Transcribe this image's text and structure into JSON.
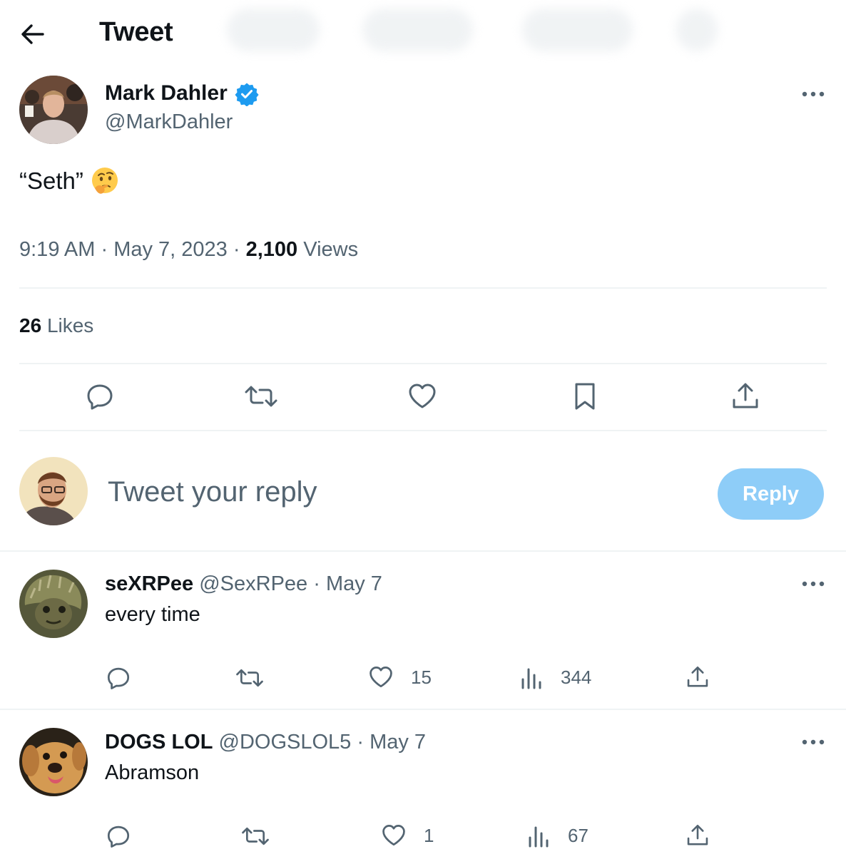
{
  "header": {
    "title": "Tweet"
  },
  "tweet": {
    "author_name": "Mark Dahler",
    "author_handle": "@MarkDahler",
    "text": "“Seth”",
    "time": "9:19 AM",
    "date": "May 7, 2023",
    "views_count": "2,100",
    "views_label": "Views",
    "likes_count": "26",
    "likes_label": "Likes"
  },
  "composer": {
    "placeholder": "Tweet your reply",
    "reply_button": "Reply"
  },
  "replies": [
    {
      "name": "seXRPee",
      "handle": "@SexRPee",
      "date": "May 7",
      "text": "every time",
      "likes": "15",
      "views": "344"
    },
    {
      "name": "DOGS LOL",
      "handle": "@DOGSLOL5",
      "date": "May 7",
      "text": "Abramson",
      "likes": "1",
      "views": "67"
    }
  ],
  "separator": "·",
  "colors": {
    "accent": "#1d9bf0",
    "reply_button_disabled": "#8ecdf8",
    "muted_text": "#536471",
    "divider": "#eff3f4"
  }
}
